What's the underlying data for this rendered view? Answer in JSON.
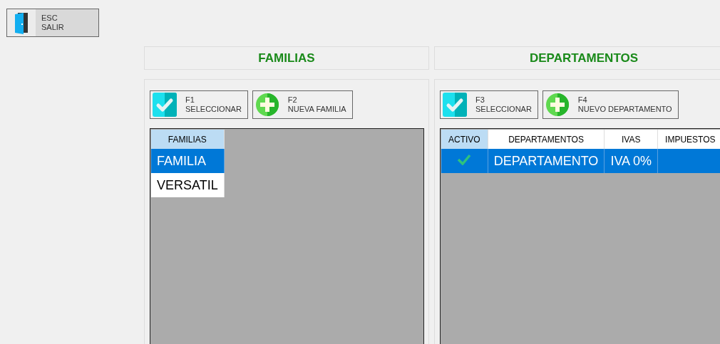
{
  "exit_button": {
    "key": "ESC",
    "label": "SALIR"
  },
  "panels": [
    {
      "title": "FAMILIAS",
      "buttons": [
        {
          "kind": "select",
          "key": "F1",
          "label": "SELECCIONAR"
        },
        {
          "kind": "add",
          "key": "F2",
          "label": "NUEVA FAMILIA"
        }
      ],
      "table": {
        "columns": [
          {
            "kind": "text",
            "label": "FAMILIAS",
            "selected": true
          }
        ],
        "rows": [
          {
            "selected": true,
            "cells": [
              "FAMILIA"
            ]
          },
          {
            "selected": false,
            "cells": [
              "VERSATIL"
            ]
          }
        ]
      }
    },
    {
      "title": "DEPARTAMENTOS",
      "buttons": [
        {
          "kind": "select",
          "key": "F3",
          "label": "SELECCIONAR"
        },
        {
          "kind": "add",
          "key": "F4",
          "label": "NUEVO DEPARTAMENTO"
        }
      ],
      "table": {
        "columns": [
          {
            "kind": "check",
            "label": "ACTIVO",
            "selected": true
          },
          {
            "kind": "text",
            "label": "DEPARTAMENTOS",
            "selected": false
          },
          {
            "kind": "text",
            "label": "IVAS",
            "selected": false
          },
          {
            "kind": "text",
            "label": "IMPUESTOS",
            "selected": false
          }
        ],
        "rows": [
          {
            "selected": true,
            "cells": [
              true,
              "DEPARTAMENTO",
              "IVA 0%",
              ""
            ]
          }
        ]
      }
    }
  ]
}
